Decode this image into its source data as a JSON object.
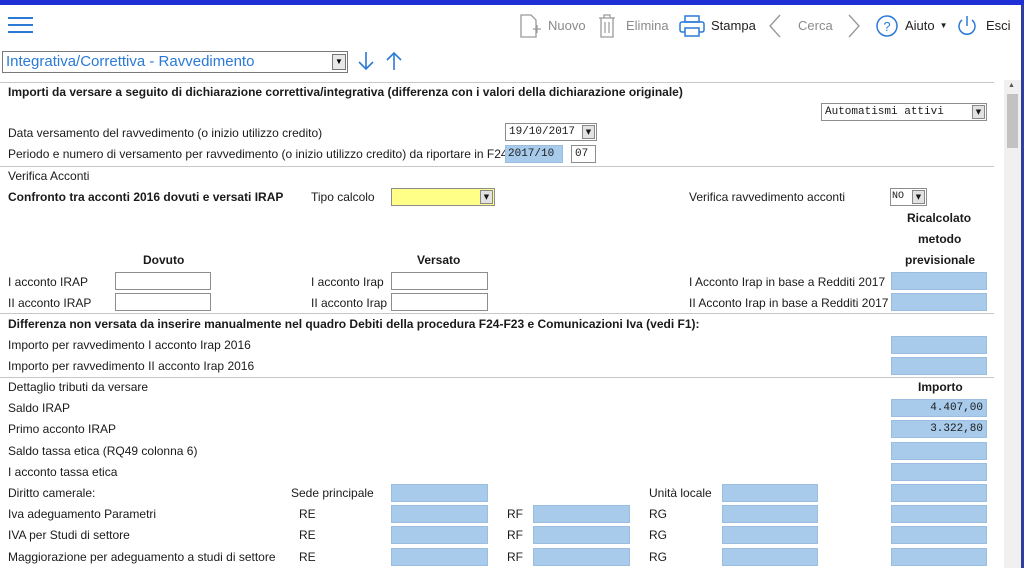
{
  "toolbar": {
    "nuovo": "Nuovo",
    "elimina": "Elimina",
    "stampa": "Stampa",
    "cerca": "Cerca",
    "aiuto": "Aiuto",
    "esci": "Esci"
  },
  "form_selector": {
    "value": "Integrativa/Correttiva - Ravvedimento"
  },
  "section1": {
    "title": "Importi da versare a seguito di dichiarazione correttiva/integrativa (differenza con i valori della dichiarazione originale)",
    "automatismi": "Automatismi attivi",
    "data_label": "Data versamento del ravvedimento (o inizio utilizzo credito)",
    "data_value": "19/10/2017",
    "periodo_label": "Periodo e numero di versamento per ravvedimento (o inizio utilizzo credito) da riportare in F24",
    "periodo_value": "2017/10",
    "numero_value": "07"
  },
  "verifica": {
    "title": "Verifica Acconti",
    "confronto": "Confronto tra acconti 2016 dovuti e versati IRAP",
    "tipo_calcolo": "Tipo calcolo",
    "tipo_calcolo_value": "",
    "verifica_rav": "Verifica ravvedimento acconti",
    "verifica_rav_value": "NO",
    "ricalcolato_1": "Ricalcolato",
    "ricalcolato_2": "metodo",
    "ricalcolato_3": "previsionale",
    "dovuto": "Dovuto",
    "versato": "Versato",
    "acc1_irap": "I acconto IRAP",
    "acc2_irap": "II acconto IRAP",
    "acc1_irap_v": "I acconto Irap",
    "acc2_irap_v": "II acconto Irap",
    "acc1_redditi": "I Acconto Irap in base a Redditi 2017",
    "acc2_redditi": "II Acconto Irap in base a Redditi 2017"
  },
  "differenza": {
    "title": "Differenza non versata da inserire manualmente nel quadro Debiti della procedura F24-F23 e Comunicazioni Iva (vedi F1):",
    "rav1": "Importo per ravvedimento I acconto Irap 2016",
    "rav2": "Importo per ravvedimento II acconto Irap 2016"
  },
  "dettaglio": {
    "title": "Dettaglio tributi da versare",
    "importo": "Importo",
    "saldo_irap": "Saldo IRAP",
    "saldo_irap_value": "4.407,00",
    "primo_acc": "Primo acconto IRAP",
    "primo_acc_value": "3.322,80",
    "saldo_etica": "Saldo tassa etica (RQ49 colonna 6)",
    "acc_etica": "I acconto tassa etica",
    "diritto": "Diritto camerale:",
    "sede": "Sede principale",
    "unita": "Unità locale",
    "iva_param": "Iva adeguamento Parametri",
    "iva_studi": "IVA per Studi di settore",
    "magg": "Maggiorazione per adeguamento a studi di settore",
    "re": "RE",
    "rf": "RF",
    "rg": "RG"
  },
  "colors": {
    "accent": "#2a7ad6",
    "field_blue": "#a8cbec",
    "field_yellow": "#ffff88",
    "top_strip": "#1f2fd6"
  }
}
